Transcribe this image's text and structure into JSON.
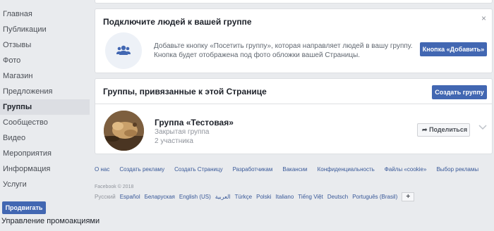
{
  "sidebar": {
    "items": [
      {
        "label": "Главная"
      },
      {
        "label": "Публикации"
      },
      {
        "label": "Отзывы"
      },
      {
        "label": "Фото"
      },
      {
        "label": "Магазин"
      },
      {
        "label": "Предложения"
      },
      {
        "label": "Группы",
        "active": true
      },
      {
        "label": "Сообщество"
      },
      {
        "label": "Видео"
      },
      {
        "label": "Мероприятия"
      },
      {
        "label": "Информация"
      },
      {
        "label": "Услуги"
      }
    ],
    "promote_label": "Продвигать",
    "promo_manage_label": "Управление промоакциями"
  },
  "connect": {
    "title": "Подключите людей к вашей группе",
    "description": "Добавьте кнопку «Посетить группу», которая направляет людей в вашу группу. Кнопка будет отображена под фото обложки вашей Страницы.",
    "add_button": "Кнопка «Добавить»",
    "close": "×"
  },
  "groups": {
    "title": "Группы, привязанные к этой Странице",
    "create_button": "Создать группу",
    "items": [
      {
        "name": "Группа «Тестовая»",
        "type": "Закрытая группа",
        "members": "2 участника",
        "share_label": "Поделиться"
      }
    ]
  },
  "footer": {
    "links": [
      "О нас",
      "Создать рекламу",
      "Создать Страницу",
      "Разработчикам",
      "Вакансии",
      "Конфиденциальность",
      "Файлы «cookie»",
      "Выбор рекламы"
    ],
    "copyright": "Facebook © 2018",
    "languages": [
      "Русский",
      "Español",
      "Беларуская",
      "English (US)",
      "العربية",
      "Türkçe",
      "Polski",
      "Italiano",
      "Tiếng Việt",
      "Deutsch",
      "Português (Brasil)"
    ],
    "plus": "+"
  },
  "colors": {
    "accent": "#4267b2",
    "link": "#385898",
    "background": "#e9ebee"
  }
}
